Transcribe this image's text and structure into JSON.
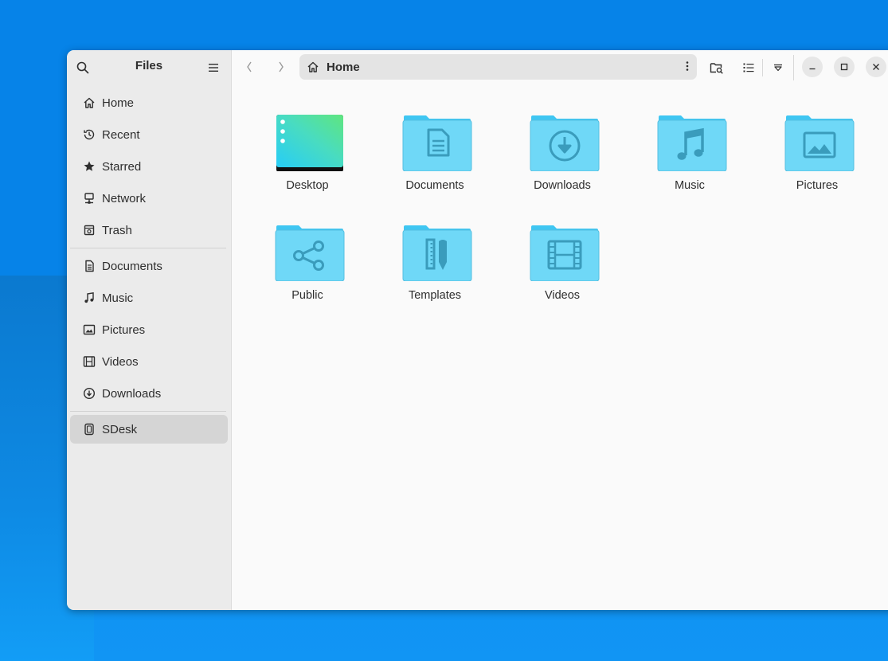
{
  "sidebar": {
    "title": "Files",
    "places": [
      {
        "label": "Home",
        "icon": "home-icon"
      },
      {
        "label": "Recent",
        "icon": "clock-icon"
      },
      {
        "label": "Starred",
        "icon": "star-icon"
      },
      {
        "label": "Network",
        "icon": "network-icon"
      },
      {
        "label": "Trash",
        "icon": "trash-icon"
      }
    ],
    "bookmarks": [
      {
        "label": "Documents",
        "icon": "document-icon"
      },
      {
        "label": "Music",
        "icon": "music-icon"
      },
      {
        "label": "Pictures",
        "icon": "picture-icon"
      },
      {
        "label": "Videos",
        "icon": "video-icon"
      },
      {
        "label": "Downloads",
        "icon": "download-icon"
      }
    ],
    "devices": [
      {
        "label": "SDesk",
        "icon": "drive-icon",
        "active": true
      }
    ]
  },
  "toolbar": {
    "location": "Home"
  },
  "files": [
    {
      "label": "Desktop",
      "icon": "desktop-folder-icon"
    },
    {
      "label": "Documents",
      "icon": "documents-folder-icon"
    },
    {
      "label": "Downloads",
      "icon": "downloads-folder-icon"
    },
    {
      "label": "Music",
      "icon": "music-folder-icon"
    },
    {
      "label": "Pictures",
      "icon": "pictures-folder-icon"
    },
    {
      "label": "Public",
      "icon": "public-folder-icon"
    },
    {
      "label": "Templates",
      "icon": "templates-folder-icon"
    },
    {
      "label": "Videos",
      "icon": "videos-folder-icon"
    }
  ],
  "colors": {
    "desktop_bg": "#0683e8",
    "folder_body": "#6fd8f7",
    "folder_tab": "#3fc6f2",
    "folder_glyph": "#3a9cbc",
    "sidebar_bg": "#ebebeb",
    "sidebar_active": "#d5d5d5"
  }
}
